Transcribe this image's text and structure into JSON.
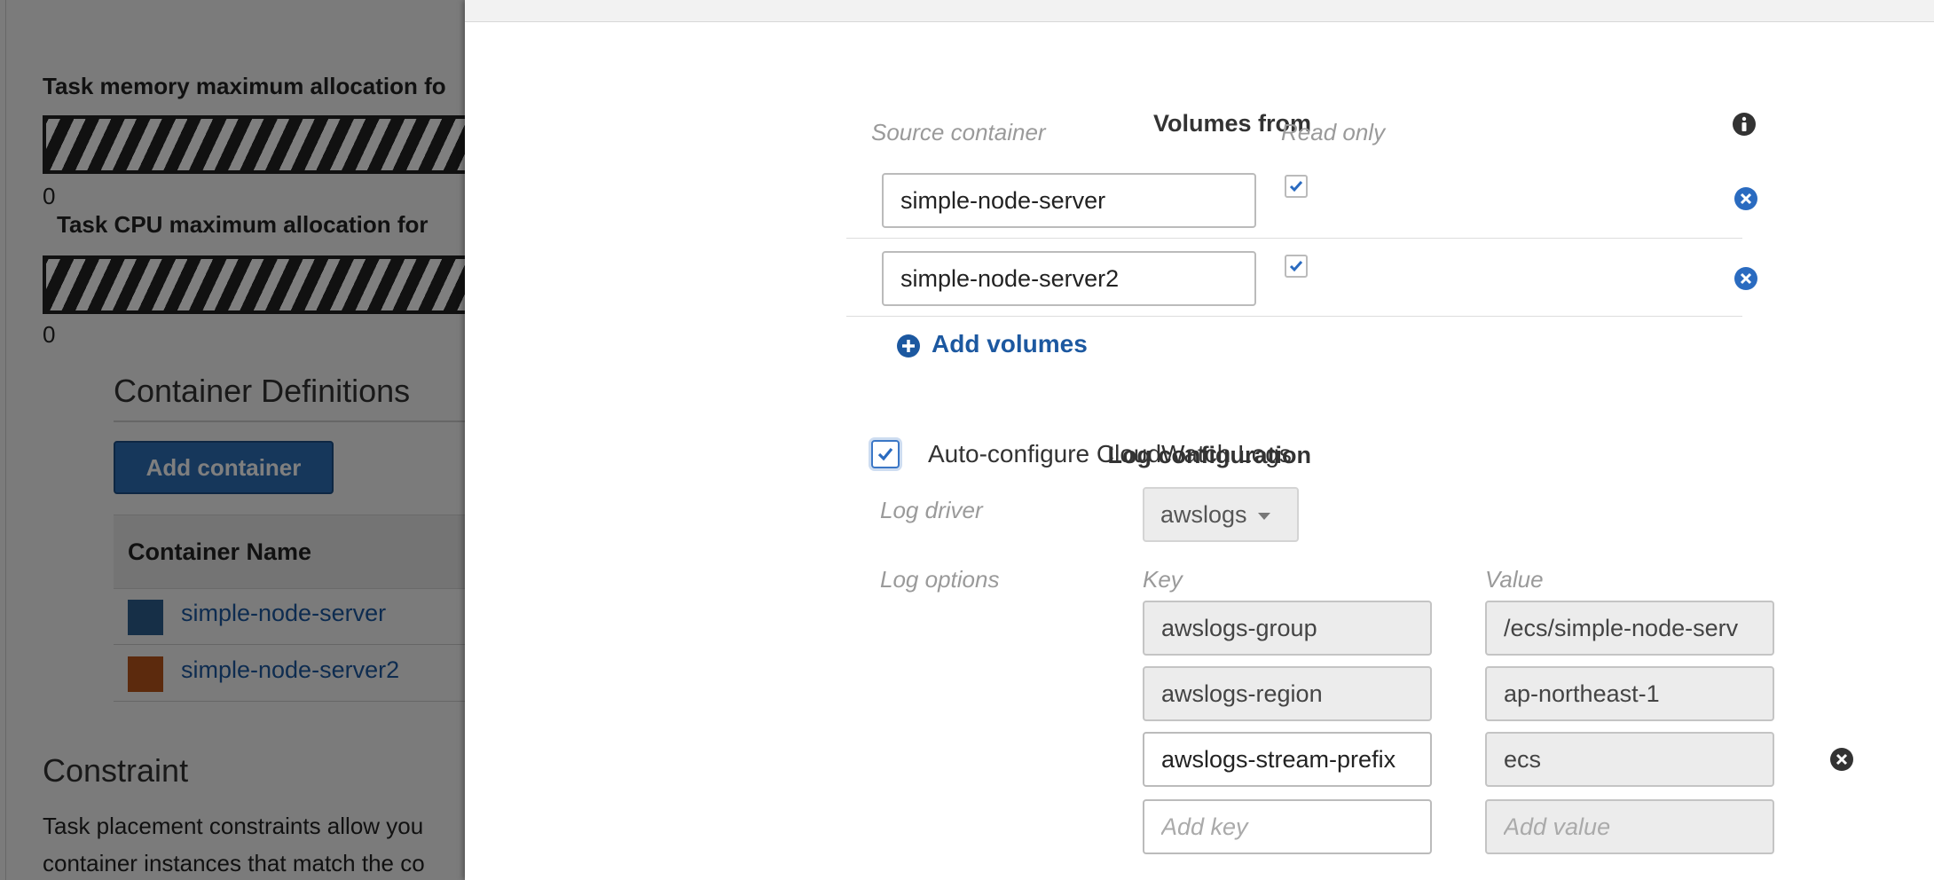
{
  "background": {
    "memory_label": "Task memory maximum allocation fo",
    "cpu_label": "Task CPU maximum allocation for",
    "memory_value": "0",
    "cpu_value": "0",
    "container_definitions": {
      "title": "Container Definitions",
      "add_button": "Add container",
      "column_header": "Container Name",
      "rows": [
        {
          "name": "simple-node-server",
          "color": "#2d5f8f"
        },
        {
          "name": "simple-node-server2",
          "color": "#b9541a"
        }
      ]
    },
    "constraint": {
      "title": "Constraint",
      "text_line1": "Task placement constraints allow you",
      "text_line2": "container instances that match the co"
    }
  },
  "volumes_from": {
    "label": "Volumes from",
    "col_source": "Source container",
    "col_readonly": "Read only",
    "rows": [
      {
        "source": "simple-node-server",
        "read_only": true
      },
      {
        "source": "simple-node-server2",
        "read_only": true
      }
    ],
    "add_label": "Add volumes"
  },
  "log_configuration": {
    "label": "Log configuration",
    "auto_configure_label": "Auto-configure CloudWatch Logs",
    "auto_configure_checked": true,
    "log_driver_label": "Log driver",
    "log_driver_value": "awslogs",
    "log_options_label": "Log options",
    "col_key": "Key",
    "col_value": "Value",
    "options": [
      {
        "key": "awslogs-group",
        "value": "/ecs/simple-node-serv"
      },
      {
        "key": "awslogs-region",
        "value": "ap-northeast-1"
      },
      {
        "key": "awslogs-stream-prefix",
        "value": "ecs"
      }
    ],
    "new_key_placeholder": "Add key",
    "new_value_placeholder": "Add value"
  },
  "colors": {
    "link_blue": "#1c58a0",
    "button_blue": "#2d6eb7",
    "remove_icon_blue": "#2a6bc0"
  }
}
